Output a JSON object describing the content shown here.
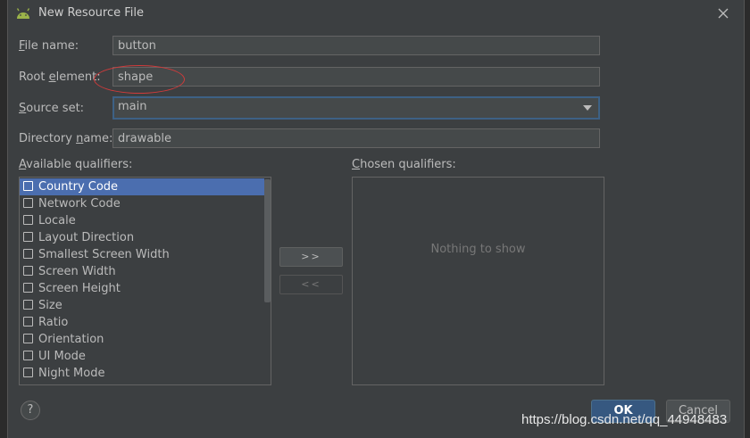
{
  "window": {
    "title": "New Resource File"
  },
  "form": {
    "file_name": {
      "label_mnemonic": "F",
      "label_rest": "ile name:",
      "value": "button"
    },
    "root_element": {
      "label_prefix": "Root ",
      "label_mnemonic": "e",
      "label_rest": "lement:",
      "value": "shape"
    },
    "source_set": {
      "label_mnemonic": "S",
      "label_rest": "ource set:",
      "value": "main"
    },
    "directory_name": {
      "label_prefix": "Directory ",
      "label_mnemonic": "n",
      "label_rest": "ame:",
      "value": "drawable"
    }
  },
  "qualifiers": {
    "available_label_prefix": "A",
    "available_label_rest": "vailable qualifiers:",
    "chosen_label_prefix": "C",
    "chosen_label_rest": "hosen qualifiers:",
    "available": [
      {
        "label": "Country Code",
        "icon": "country-code-icon"
      },
      {
        "label": "Network Code",
        "icon": "network-code-icon"
      },
      {
        "label": "Locale",
        "icon": "locale-icon"
      },
      {
        "label": "Layout Direction",
        "icon": "layout-direction-icon"
      },
      {
        "label": "Smallest Screen Width",
        "icon": "smallest-screen-width-icon"
      },
      {
        "label": "Screen Width",
        "icon": "screen-width-icon"
      },
      {
        "label": "Screen Height",
        "icon": "screen-height-icon"
      },
      {
        "label": "Size",
        "icon": "size-icon"
      },
      {
        "label": "Ratio",
        "icon": "ratio-icon"
      },
      {
        "label": "Orientation",
        "icon": "orientation-icon"
      },
      {
        "label": "UI Mode",
        "icon": "ui-mode-icon"
      },
      {
        "label": "Night Mode",
        "icon": "night-mode-icon"
      }
    ],
    "selected_available": "Country Code",
    "add_button": ">>",
    "remove_button": "<<",
    "chosen_empty": "Nothing to show"
  },
  "buttons": {
    "help": "?",
    "ok": "OK",
    "cancel": "Cancel"
  },
  "watermark": "https://blog.csdn.net/qq_44948483",
  "colors": {
    "selection": "#4b6eaf",
    "accent": "#365880",
    "annotation": "#d13b3b"
  }
}
